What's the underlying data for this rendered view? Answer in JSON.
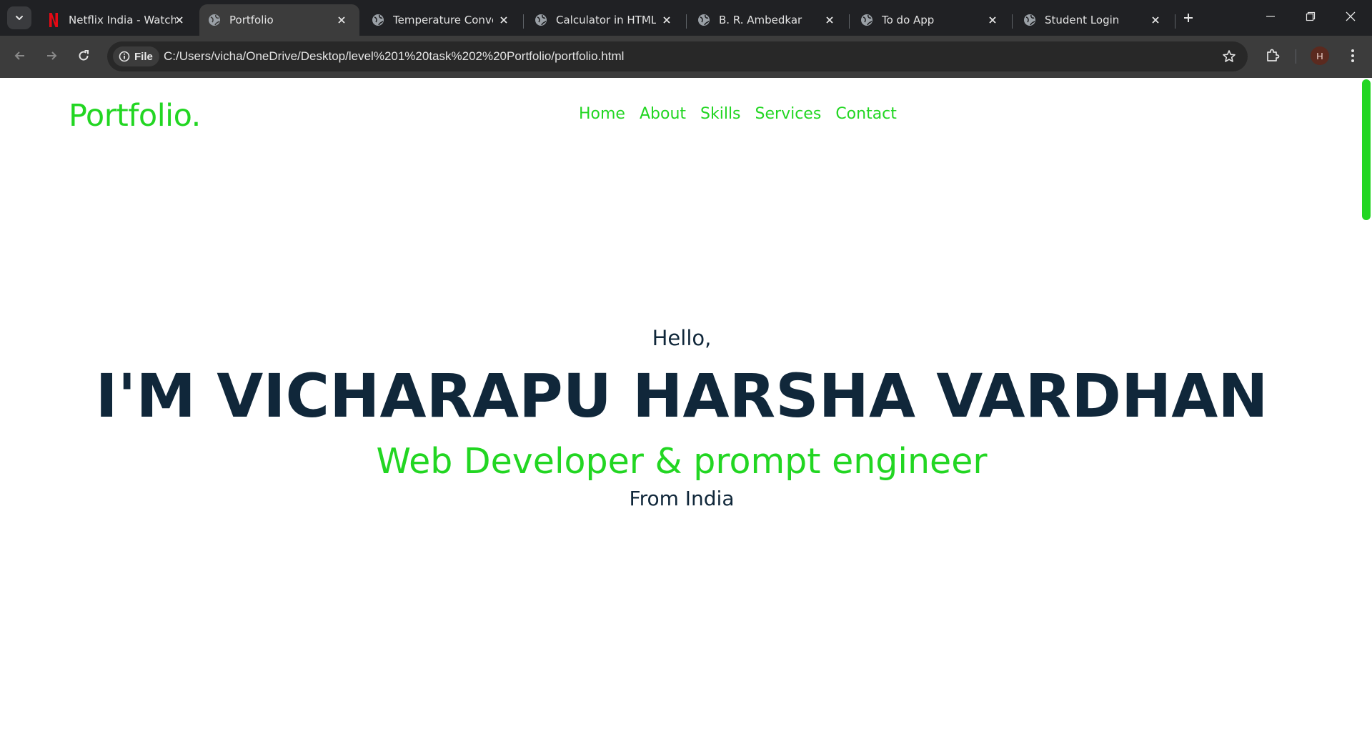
{
  "browser": {
    "tabs": [
      {
        "title": "Netflix India - Watch",
        "favicon": "netflix-logo-icon",
        "active": false
      },
      {
        "title": "Portfolio",
        "favicon": "globe-icon",
        "active": true
      },
      {
        "title": "Temperature Convert",
        "favicon": "globe-icon",
        "active": false
      },
      {
        "title": "Calculator in HTML C",
        "favicon": "globe-icon",
        "active": false
      },
      {
        "title": "B. R. Ambedkar",
        "favicon": "globe-icon",
        "active": false
      },
      {
        "title": "To do App",
        "favicon": "globe-icon",
        "active": false
      },
      {
        "title": "Student Login",
        "favicon": "globe-icon",
        "active": false
      }
    ],
    "address": {
      "chip_label": "File",
      "url": "C:/Users/vicha/OneDrive/Desktop/level%201%20task%202%20Portfolio/portfolio.html"
    },
    "profile_initial": "H",
    "colors": {
      "tabstrip": "#202124",
      "toolbar": "#3c3c3c",
      "omnibox": "#282828",
      "netflix_red": "#e50914"
    }
  },
  "site": {
    "logo": "Portfolio.",
    "nav": [
      "Home",
      "About",
      "Skills",
      "Services",
      "Contact"
    ],
    "hero": {
      "greeting": "Hello,",
      "name": "I'M VICHARAPU HARSHA VARDHAN",
      "role": "Web Developer & prompt engineer",
      "location": "From India"
    },
    "colors": {
      "accent": "#22d622",
      "text_dark": "#10273a",
      "background": "#ffffff"
    }
  }
}
